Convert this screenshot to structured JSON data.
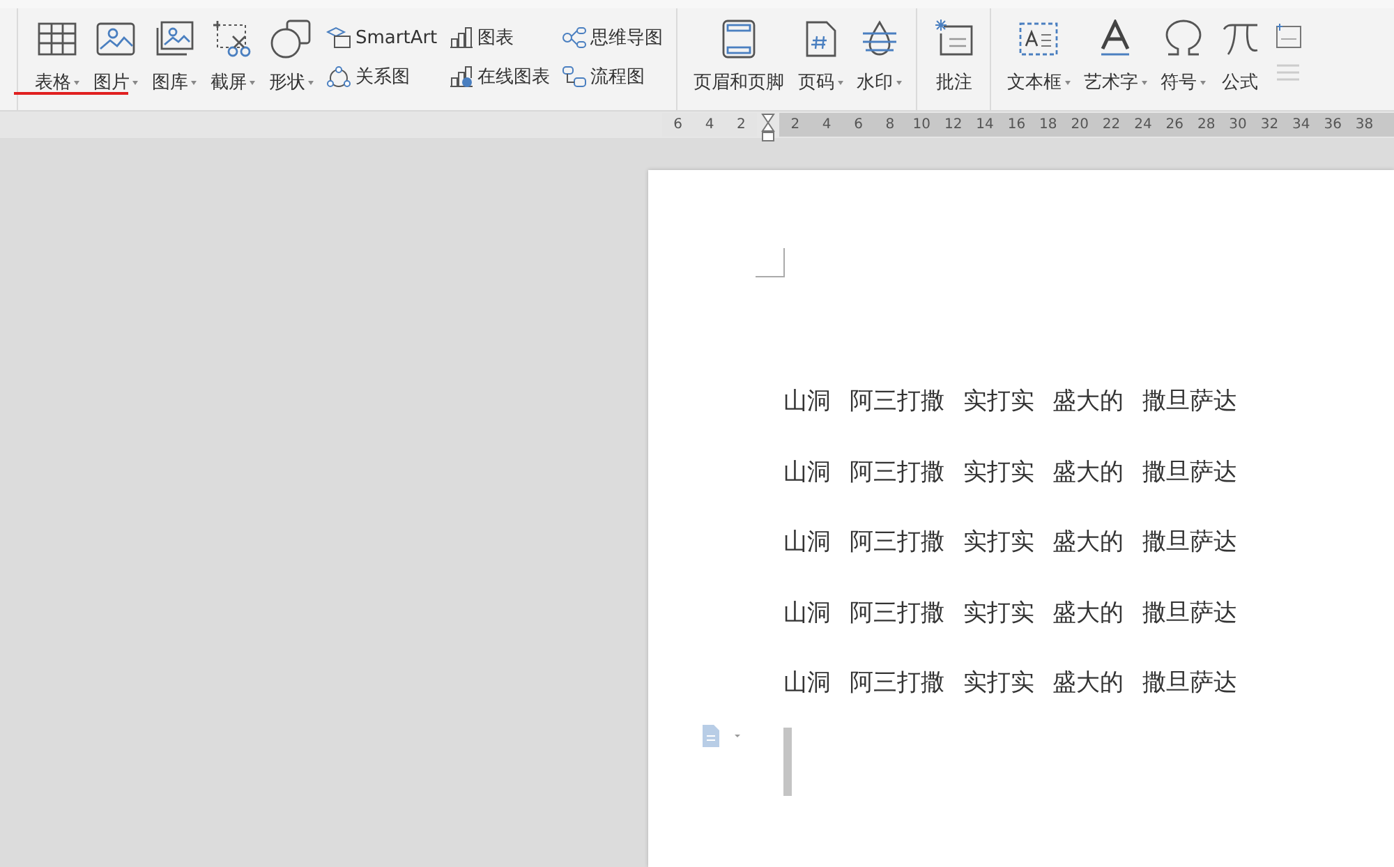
{
  "toolbar": {
    "sections": [
      {
        "items": [
          {
            "kind": "large",
            "label": "表格",
            "dropdown": true
          },
          {
            "kind": "large",
            "label": "图片",
            "dropdown": true
          },
          {
            "kind": "large",
            "label": "图库",
            "dropdown": true
          },
          {
            "kind": "large",
            "label": "截屏",
            "dropdown": true
          },
          {
            "kind": "large",
            "label": "形状",
            "dropdown": true
          },
          {
            "kind": "stack",
            "entries": [
              "SmartArt",
              "关系图"
            ]
          },
          {
            "kind": "stack",
            "entries": [
              "图表",
              "在线图表"
            ]
          },
          {
            "kind": "stack",
            "entries": [
              "思维导图",
              "流程图"
            ]
          }
        ]
      },
      {
        "items": [
          {
            "kind": "large",
            "label": "页眉和页脚",
            "dropdown": false
          },
          {
            "kind": "large",
            "label": "页码",
            "dropdown": true
          },
          {
            "kind": "large",
            "label": "水印",
            "dropdown": true
          }
        ]
      },
      {
        "items": [
          {
            "kind": "large",
            "label": "批注",
            "dropdown": false
          }
        ]
      },
      {
        "items": [
          {
            "kind": "large",
            "label": "文本框",
            "dropdown": true
          },
          {
            "kind": "large",
            "label": "艺术字",
            "dropdown": true
          },
          {
            "kind": "large",
            "label": "符号",
            "dropdown": true
          },
          {
            "kind": "large",
            "label": "公式",
            "dropdown": false
          },
          {
            "kind": "icons"
          }
        ]
      }
    ]
  },
  "ruler": {
    "left_labels": [
      "6",
      "4",
      "2"
    ],
    "right_labels": [
      "2",
      "4",
      "6",
      "8",
      "10",
      "12",
      "14",
      "16",
      "18",
      "20",
      "22",
      "24",
      "26",
      "28",
      "30",
      "32",
      "34",
      "36",
      "38"
    ]
  },
  "document": {
    "paragraphs": [
      "山洞 阿三打撒 实打实 盛大的 撒旦萨达",
      "山洞 阿三打撒 实打实 盛大的 撒旦萨达",
      "山洞 阿三打撒 实打实 盛大的 撒旦萨达",
      "山洞 阿三打撒 实打实 盛大的 撒旦萨达",
      "山洞 阿三打撒 实打实 盛大的 撒旦萨达"
    ]
  }
}
